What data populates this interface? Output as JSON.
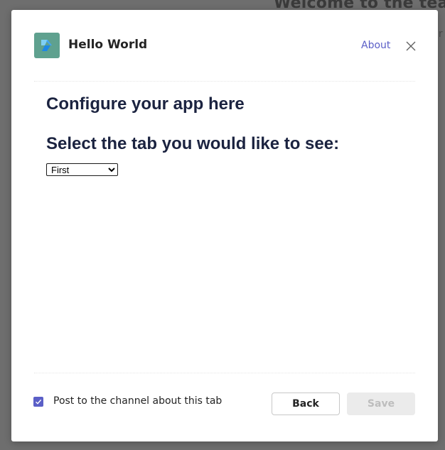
{
  "background": {
    "title": "Welcome to the team",
    "subtitle_fragment": "ir"
  },
  "dialog": {
    "app_name": "Hello World",
    "about_label": "About",
    "logo_icon": "azure-logo-icon",
    "close_icon": "close-icon",
    "accent_color": "#5b5fc7",
    "logo_bg_color": "#5fa18f"
  },
  "content": {
    "heading": "Configure your app here",
    "select_heading": "Select the tab you would like to see:",
    "tab_select": {
      "selected": "First"
    }
  },
  "footer": {
    "post_checkbox_checked": true,
    "post_label": "Post to the channel about this tab",
    "back_label": "Back",
    "save_label": "Save"
  }
}
